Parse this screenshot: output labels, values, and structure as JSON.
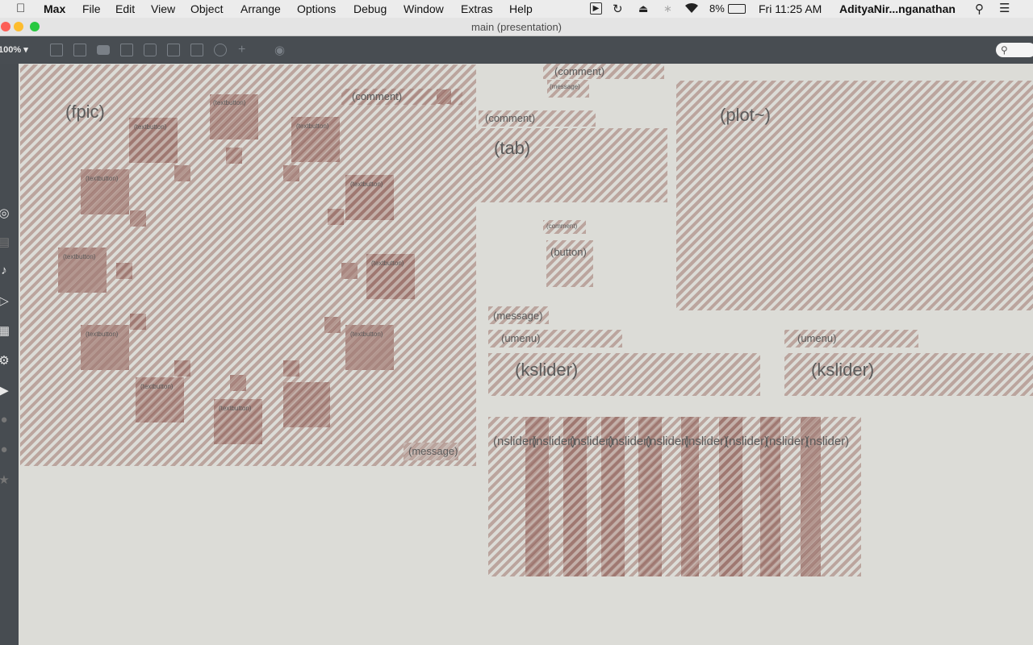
{
  "menubar": {
    "app": "Max",
    "items": [
      "File",
      "Edit",
      "View",
      "Object",
      "Arrange",
      "Options",
      "Debug",
      "Window",
      "Extras",
      "Help"
    ],
    "battery": "8%",
    "clock": "Fri 11:25 AM",
    "user": "AdityaNir...nganathan"
  },
  "window": {
    "title": "main (presentation)",
    "zoom": "100%"
  },
  "patcher": {
    "fpic": "(fpic)",
    "textbutton": "(textbutton)",
    "comment": "(comment)",
    "message": "(message)",
    "tab": "(tab)",
    "plot": "(plot~)",
    "button": "(button)",
    "umenu": "(umenu)",
    "kslider": "(kslider)",
    "nslider": "(nslider)"
  }
}
